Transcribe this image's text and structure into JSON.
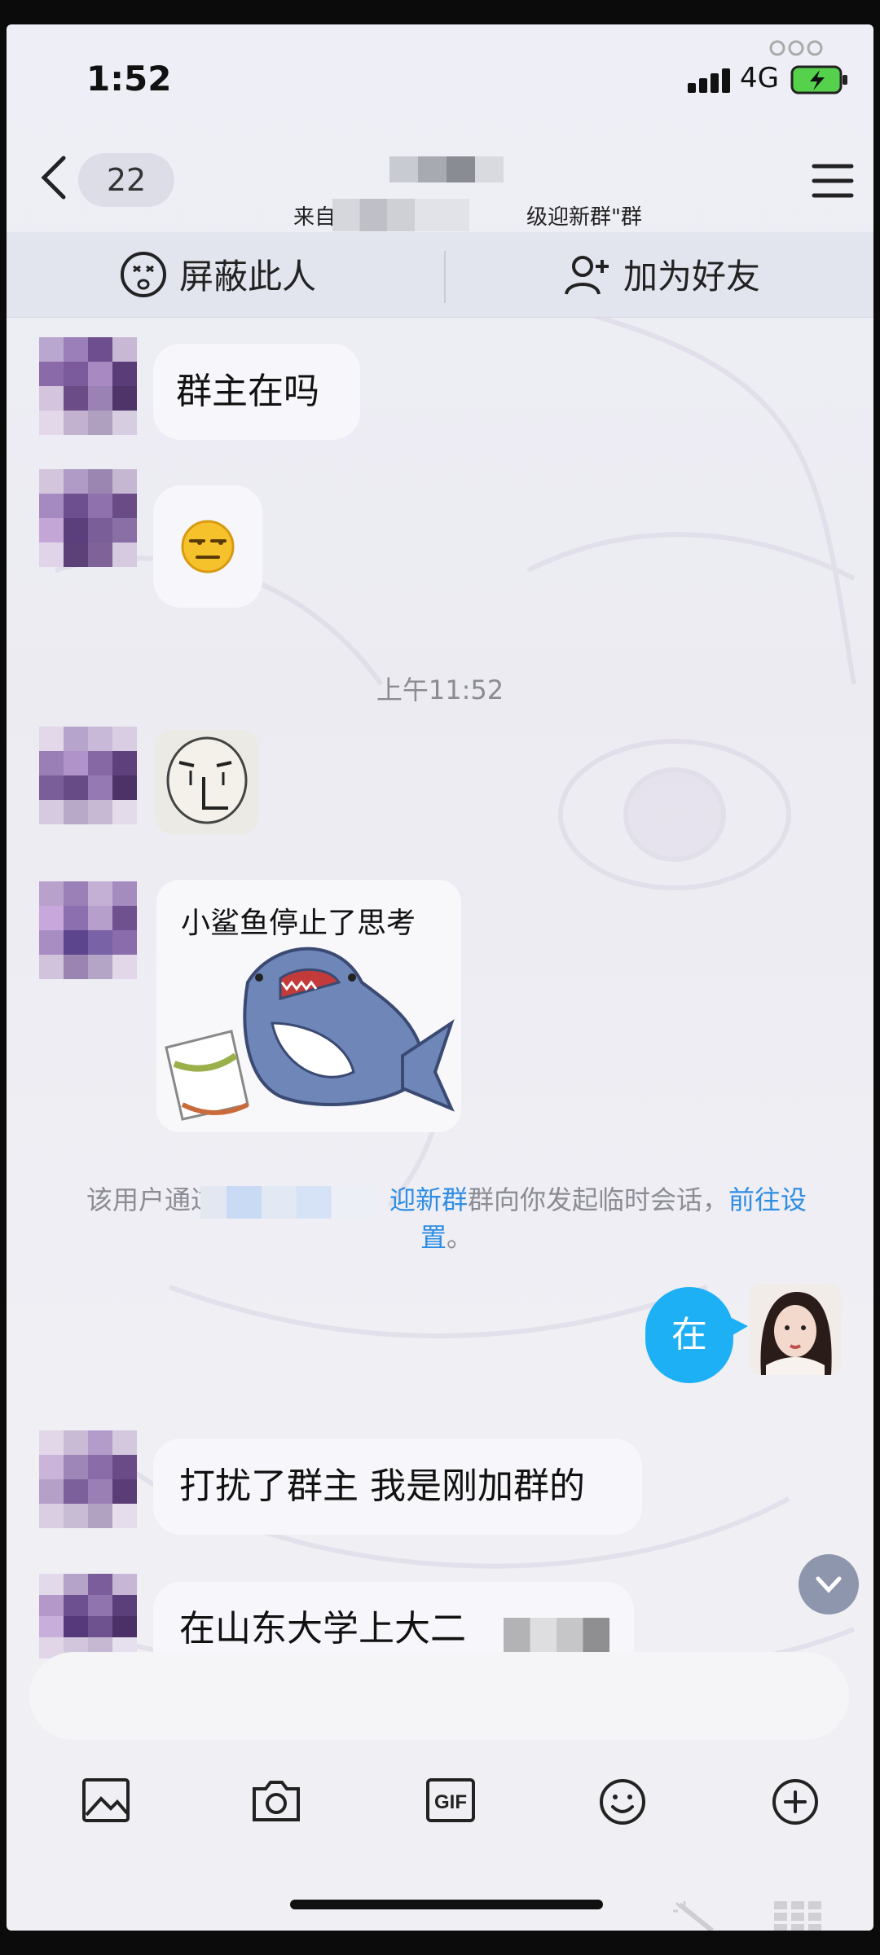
{
  "status_bar": {
    "time": "1:52",
    "network": "4G"
  },
  "nav": {
    "back_count": "22",
    "subtitle": "来自\"",
    "subtitle_end": "级迎新群\"群"
  },
  "actions": {
    "block_label": "屏蔽此人",
    "add_friend_label": "加为好友"
  },
  "messages": {
    "msg1": "群主在吗",
    "timestamp": "上午11:52",
    "sticker_caption": "小鲨鱼停止了思考",
    "notice_prefix": "该用户通过",
    "notice_group": "迎新群",
    "notice_mid": "群向你发起临时会话，",
    "notice_link": "前往设置",
    "notice_end": "。",
    "sent": "在",
    "msg2": "打扰了群主 我是刚加群的",
    "msg3": "在山东大学上大二"
  },
  "colors": {
    "accent_blue": "#1eb0f5",
    "link_blue": "#2f8de4"
  },
  "toolbar": [
    "image-icon",
    "camera-icon",
    "gif-icon",
    "emoji-icon",
    "plus-icon"
  ]
}
